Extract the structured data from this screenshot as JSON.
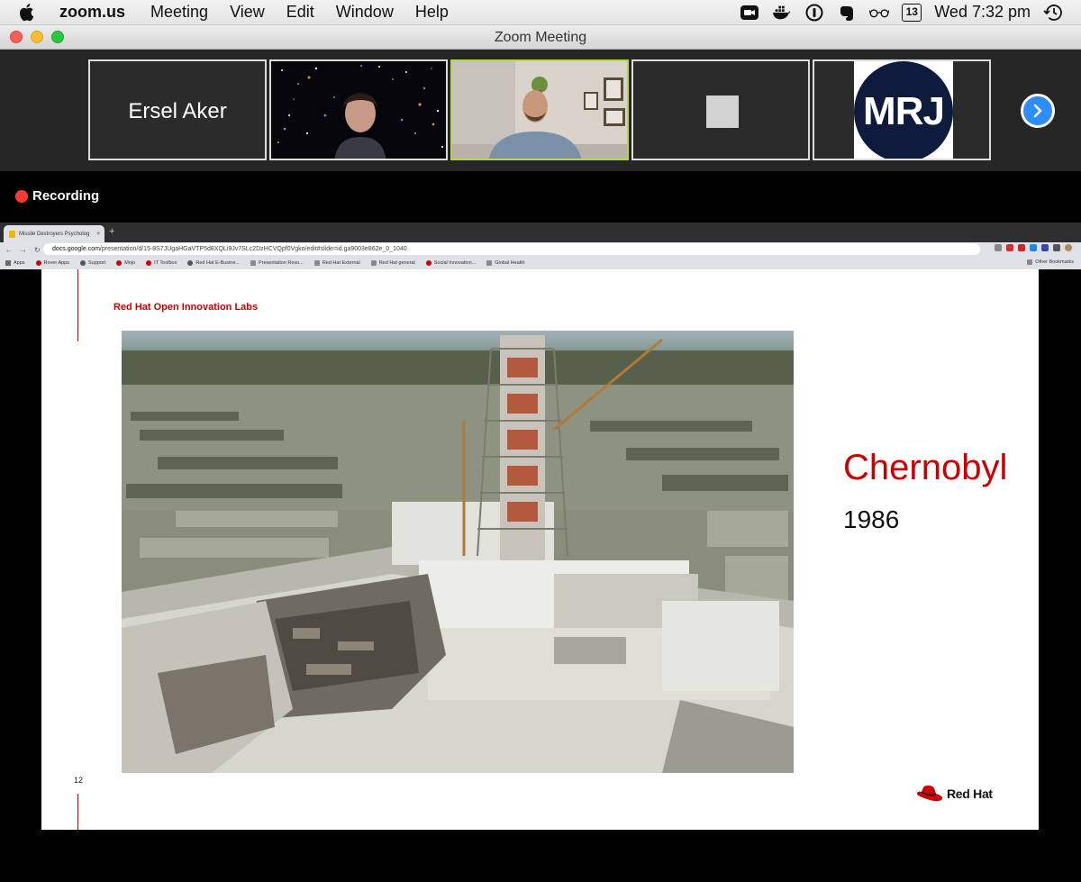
{
  "menubar": {
    "app_name": "zoom.us",
    "menus": [
      "Meeting",
      "View",
      "Edit",
      "Window",
      "Help"
    ],
    "calendar_day": "13",
    "clock": "Wed 7:32 pm"
  },
  "window": {
    "title": "Zoom Meeting"
  },
  "gallery": {
    "participant_name": "Ersel Aker",
    "logo_text": "MRJ",
    "active_border_color": "#b6d64a"
  },
  "recording": {
    "label": "Recording"
  },
  "browser": {
    "tab_title": "Missile Destroyers Psycholog",
    "url_domain": "docs.google.com",
    "url_path": "/presentation/d/15-8S7JUgaHGaVTP5d8XQLi9Jv7SLc2DzHCVQpf0Vgko/edit#slide=id.ga9003e862e_0_1040",
    "bookmarks": [
      {
        "label": "Apps",
        "icon": "grid"
      },
      {
        "label": "Rover Apps",
        "icon": "redhat"
      },
      {
        "label": "Support",
        "icon": "globe"
      },
      {
        "label": "Mojo",
        "icon": "redhat"
      },
      {
        "label": "IT Toolbox",
        "icon": "redhat"
      },
      {
        "label": "Red Hat E-Busine...",
        "icon": "globe"
      },
      {
        "label": "Presentation Reso...",
        "icon": "folder"
      },
      {
        "label": "Red Hat External",
        "icon": "folder"
      },
      {
        "label": "Red Hat general",
        "icon": "folder"
      },
      {
        "label": "Social Innovation...",
        "icon": "redhat"
      },
      {
        "label": "Global Health",
        "icon": "folder"
      }
    ],
    "other_bookmarks": "Other Bookmarks"
  },
  "slide": {
    "brand_line": "Red Hat Open Innovation Labs",
    "title": "Chernobyl",
    "year": "1986",
    "page_number": "12",
    "logo_text": "Red Hat",
    "accent_color": "#cc0000"
  }
}
